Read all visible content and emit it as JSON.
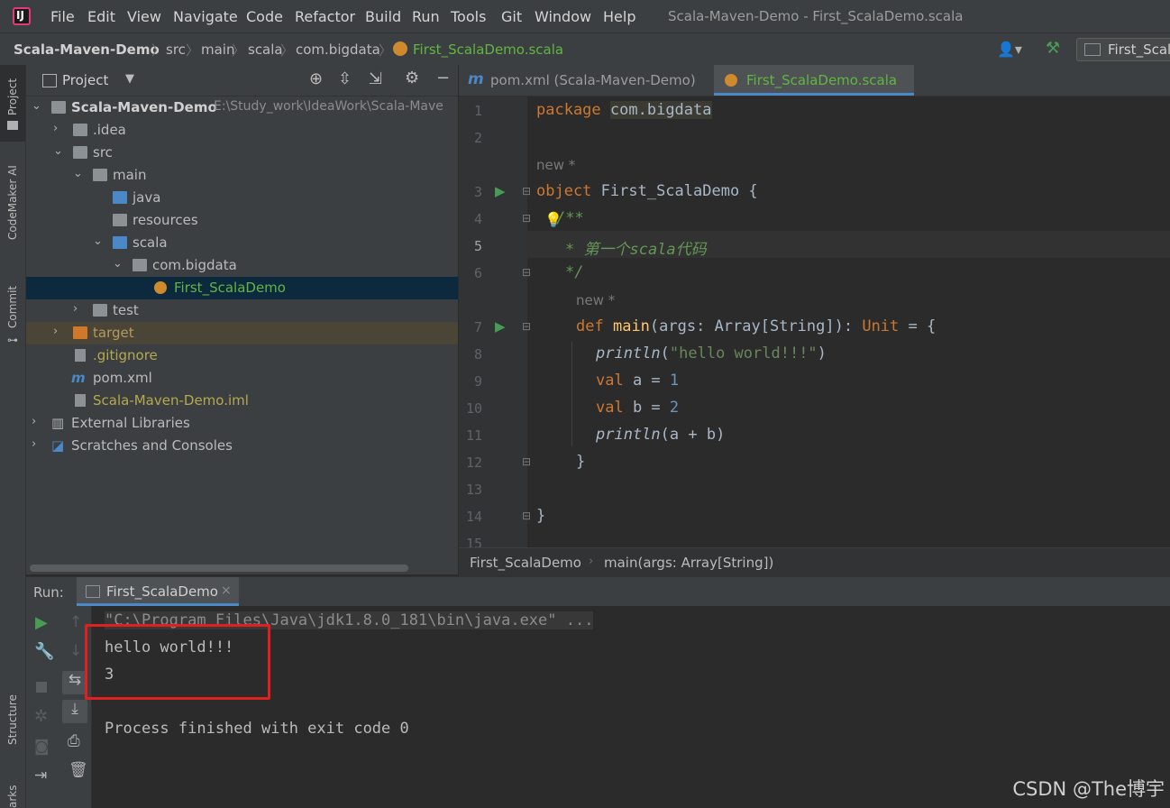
{
  "menubar": {
    "items": [
      "File",
      "Edit",
      "View",
      "Navigate",
      "Code",
      "Refactor",
      "Build",
      "Run",
      "Tools",
      "Git",
      "Window",
      "Help"
    ],
    "window_title": "Scala-Maven-Demo - First_ScalaDemo.scala"
  },
  "navbar": {
    "crumbs": [
      "Scala-Maven-Demo",
      "src",
      "main",
      "scala",
      "com.bigdata",
      "First_ScalaDemo.scala"
    ],
    "run_config": "First_Scal"
  },
  "left_strip": {
    "project": "Project",
    "codemaker": "CodeMaker AI",
    "commit": "Commit",
    "structure": "Structure",
    "bookmarks": "arks"
  },
  "project_panel": {
    "title": "Project",
    "tree": [
      {
        "label": "Scala-Maven-Demo",
        "path": "E:\\Study_work\\IdeaWork\\Scala-Mave"
      },
      {
        "label": ".idea"
      },
      {
        "label": "src"
      },
      {
        "label": "main"
      },
      {
        "label": "java"
      },
      {
        "label": "resources"
      },
      {
        "label": "scala"
      },
      {
        "label": "com.bigdata"
      },
      {
        "label": "First_ScalaDemo"
      },
      {
        "label": "test"
      },
      {
        "label": "target"
      },
      {
        "label": ".gitignore"
      },
      {
        "label": "pom.xml"
      },
      {
        "label": "Scala-Maven-Demo.iml"
      },
      {
        "label": "External Libraries"
      },
      {
        "label": "Scratches and Consoles"
      }
    ]
  },
  "editor": {
    "tabs": [
      {
        "label": "pom.xml (Scala-Maven-Demo)",
        "icon": "m"
      },
      {
        "label": "First_ScalaDemo.scala",
        "icon": "o"
      }
    ],
    "line_numbers": [
      "1",
      "2",
      "3",
      "4",
      "5",
      "6",
      "7",
      "8",
      "9",
      "10",
      "11",
      "12",
      "13",
      "14",
      "15"
    ],
    "hints": [
      "new *",
      "new *"
    ],
    "code": {
      "l1_kw": "package",
      "l1_pkg": "com.bigdata",
      "l3_kw": "object",
      "l3_name": " First_ScalaDemo {",
      "l4": "/**",
      "l5": "* 第一个scala代码",
      "l6": "*/",
      "l7_kw": "def",
      "l7_fn": "main",
      "l7_a": "(args: Array[String]): ",
      "l7_unit": "Unit",
      "l7_b": " = {",
      "l8_fn": "println",
      "l8_o": "(",
      "l8_str": "\"hello world!!!\"",
      "l8_c": ")",
      "l9_kw": "val",
      "l9_a": " a = ",
      "l9_n": "1",
      "l10_kw": "val",
      "l10_a": " b = ",
      "l10_n": "2",
      "l11_fn": "println",
      "l11_a": "(a + b)",
      "l12": "}",
      "l14": "}"
    },
    "breadcrumb": [
      "First_ScalaDemo",
      "main(args: Array[String])"
    ]
  },
  "run_panel": {
    "label": "Run:",
    "tab": "First_ScalaDemo",
    "console": [
      "\"C:\\Program Files\\Java\\jdk1.8.0_181\\bin\\java.exe\" ...",
      "hello world!!!",
      "3",
      "",
      "Process finished with exit code 0"
    ]
  },
  "watermark": "CSDN @The博宇",
  "colors": {
    "accent_green": "#499c54",
    "highlight_red": "#e01f1f",
    "selection": "#0d293e"
  }
}
